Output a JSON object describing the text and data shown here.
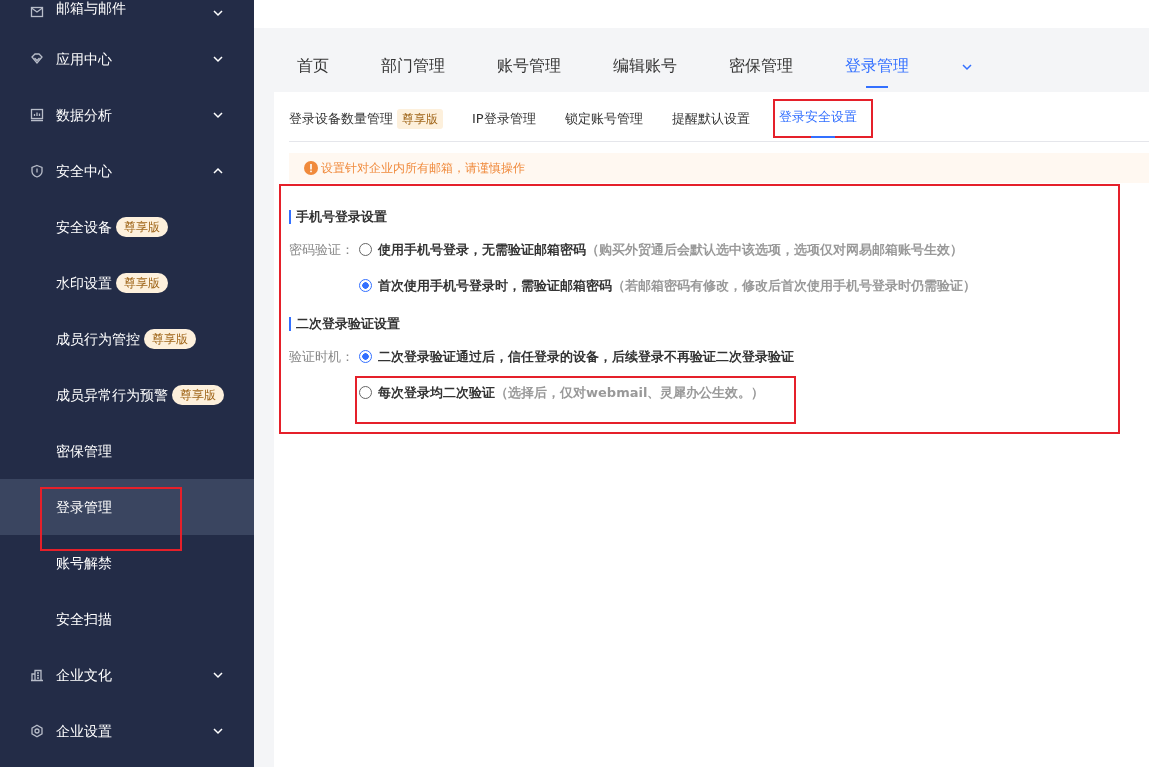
{
  "sidebar": {
    "items": [
      {
        "label": "邮箱与邮件",
        "expanded": false
      },
      {
        "label": "应用中心",
        "expanded": false
      },
      {
        "label": "数据分析",
        "expanded": false
      },
      {
        "label": "安全中心",
        "expanded": true,
        "children": [
          {
            "label": "安全设备",
            "badge": "尊享版",
            "selected": false,
            "highlighted": false
          },
          {
            "label": "水印设置",
            "badge": "尊享版",
            "selected": false,
            "highlighted": false
          },
          {
            "label": "成员行为管控",
            "badge": "尊享版",
            "selected": false,
            "highlighted": false
          },
          {
            "label": "成员异常行为预警",
            "badge": "尊享版",
            "selected": false,
            "highlighted": false
          },
          {
            "label": "密保管理",
            "selected": false,
            "highlighted": false
          },
          {
            "label": "登录管理",
            "selected": true,
            "highlighted": true
          },
          {
            "label": "账号解禁",
            "selected": false,
            "highlighted": false
          },
          {
            "label": "安全扫描",
            "selected": false,
            "highlighted": false
          }
        ]
      },
      {
        "label": "企业文化",
        "expanded": false
      },
      {
        "label": "企业设置",
        "expanded": false
      }
    ]
  },
  "tabs": [
    {
      "label": "首页",
      "selected": false
    },
    {
      "label": "部门管理",
      "selected": false
    },
    {
      "label": "账号管理",
      "selected": false
    },
    {
      "label": "编辑账号",
      "selected": false
    },
    {
      "label": "密保管理",
      "selected": false
    },
    {
      "label": "登录管理",
      "selected": true
    }
  ],
  "subtabs": [
    {
      "label": "登录设备数量管理",
      "badge": "尊享版",
      "selected": false,
      "highlighted": false
    },
    {
      "label": "IP登录管理",
      "selected": false,
      "highlighted": false
    },
    {
      "label": "锁定账号管理",
      "selected": false,
      "highlighted": false
    },
    {
      "label": "提醒默认设置",
      "selected": false,
      "highlighted": false
    },
    {
      "label": "登录安全设置",
      "selected": true,
      "highlighted": true
    }
  ],
  "alert": {
    "text": "设置针对企业内所有邮箱，请谨慎操作"
  },
  "form": {
    "highlighted": true,
    "sections": [
      {
        "title": "手机号登录设置",
        "label": "密码验证：",
        "options": [
          {
            "text": "使用手机号登录，无需验证邮箱密码",
            "note": "（购买外贸通后会默认选中该选项，选项仅对网易邮箱账号生效）",
            "selected": false,
            "highlighted": false
          },
          {
            "text": "首次使用手机号登录时，需验证邮箱密码",
            "note": "（若邮箱密码有修改，修改后首次使用手机号登录时仍需验证）",
            "selected": true,
            "highlighted": false
          }
        ]
      },
      {
        "title": "二次登录验证设置",
        "label": "验证时机：",
        "options": [
          {
            "text": "二次登录验证通过后，信任登录的设备，后续登录不再验证二次登录验证",
            "selected": true,
            "highlighted": false
          },
          {
            "text": "每次登录均二次验证",
            "note": "（选择后，仅对webmail、灵犀办公生效。）",
            "selected": false,
            "highlighted": true
          }
        ]
      }
    ]
  }
}
